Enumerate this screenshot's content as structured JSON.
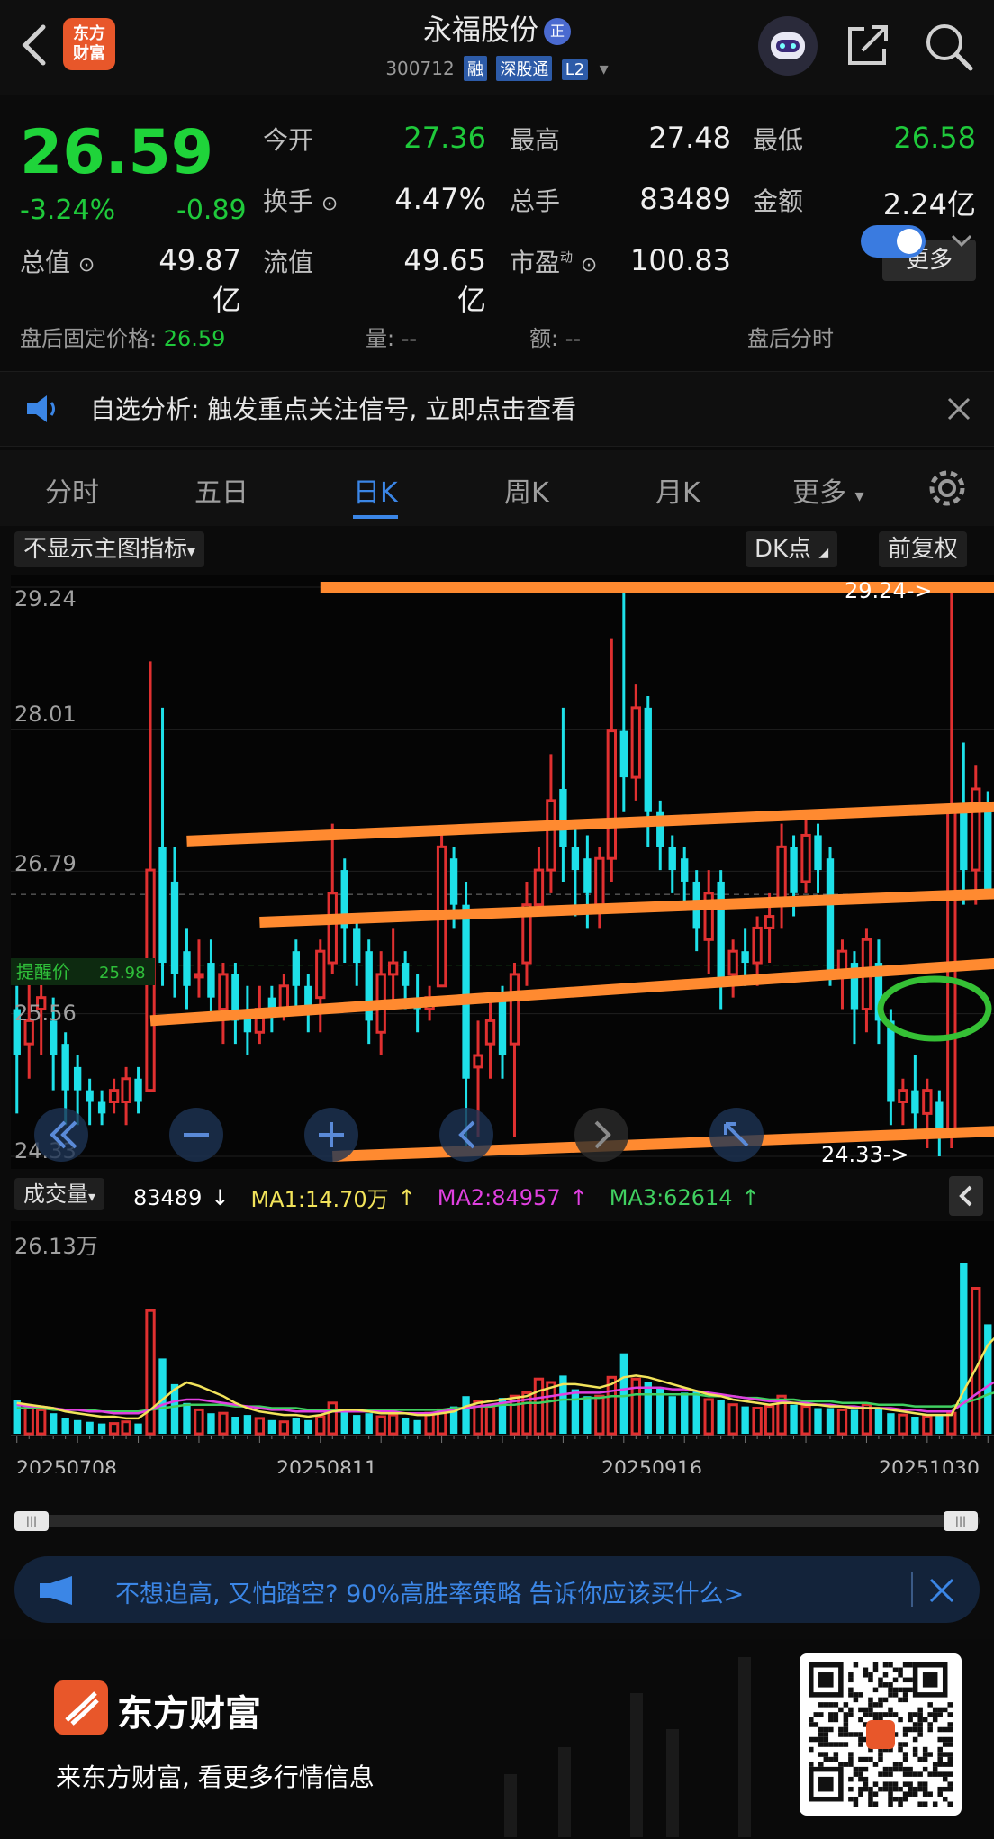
{
  "header": {
    "title": "永福股份",
    "title_badge": "正",
    "code": "300712",
    "tags": [
      "融",
      "深股通",
      "L2"
    ],
    "logo_text": "东方\n财富"
  },
  "quote": {
    "price": "26.59",
    "change_pct": "-3.24%",
    "change_amt": "-0.89",
    "fields": [
      {
        "label": "今开",
        "value": "27.36",
        "color": "green"
      },
      {
        "label": "最高",
        "value": "27.48",
        "color": "white"
      },
      {
        "label": "最低",
        "value": "26.58",
        "color": "green"
      },
      {
        "label": "换手",
        "value": "4.47%",
        "color": "white"
      },
      {
        "label": "总手",
        "value": "83489",
        "color": "white"
      },
      {
        "label": "金额",
        "value": "2.24亿",
        "color": "white"
      },
      {
        "label": "总值",
        "value": "49.87亿",
        "color": "white"
      },
      {
        "label": "流值",
        "value": "49.65亿",
        "color": "white"
      },
      {
        "label": "市盈",
        "value": "100.83",
        "color": "white"
      }
    ],
    "pe_sup": "动",
    "more_label": "更多",
    "after_hours_label": "盘后固定价格:",
    "after_hours_value": "26.59",
    "vol_label": "量:",
    "vol_value": "--",
    "amt_label": "额:",
    "amt_value": "--",
    "after_hours_timeshare": "盘后分时"
  },
  "notice": {
    "text": "自选分析: 触发重点关注信号, 立即点击查看"
  },
  "tabs": [
    "分时",
    "五日",
    "日K",
    "周K",
    "月K",
    "更多"
  ],
  "active_tab": 2,
  "chart_controls": {
    "indicator": "不显示主图指标",
    "dk": "DK点",
    "adjust": "前复权",
    "alert_label": "提醒价",
    "alert_value": "25.98",
    "max_label": "29.24->",
    "min_label": "24.33->",
    "vol_indicator": "成交量",
    "vol_value": "83489",
    "ma1": "MA1:14.70万",
    "ma2": "MA2:84957",
    "ma3": "MA3:62614",
    "vol_axis_top": "26.13万"
  },
  "chart_data": {
    "type": "candlestick",
    "y_ticks": [
      "29.24",
      "28.01",
      "26.79",
      "25.56",
      "24.33"
    ],
    "ylim": [
      24.33,
      29.24
    ],
    "x_ticks": [
      "20250708",
      "20250811",
      "20250916",
      "20251030"
    ],
    "colors": {
      "up": "#e03030",
      "down": "#1ee0e8",
      "trend": "#ff8a30",
      "ma1": "#f2e35a",
      "ma2": "#e040e0",
      "ma3": "#40d060",
      "circle": "#35c035"
    },
    "candles": [
      {
        "o": 25.6,
        "c": 25.2,
        "h": 25.8,
        "l": 24.7
      },
      {
        "o": 25.3,
        "c": 25.5,
        "h": 25.9,
        "l": 25.0
      },
      {
        "o": 25.6,
        "c": 25.7,
        "h": 25.9,
        "l": 25.2
      },
      {
        "o": 25.5,
        "c": 25.2,
        "h": 25.7,
        "l": 24.9
      },
      {
        "o": 25.3,
        "c": 24.9,
        "h": 25.4,
        "l": 24.6
      },
      {
        "o": 25.1,
        "c": 24.9,
        "h": 25.2,
        "l": 24.6
      },
      {
        "o": 24.9,
        "c": 24.8,
        "h": 25.0,
        "l": 24.6
      },
      {
        "o": 24.8,
        "c": 24.7,
        "h": 24.9,
        "l": 24.6
      },
      {
        "o": 24.8,
        "c": 24.9,
        "h": 25.0,
        "l": 24.7
      },
      {
        "o": 24.8,
        "c": 25.0,
        "h": 25.1,
        "l": 24.6
      },
      {
        "o": 25.0,
        "c": 24.8,
        "h": 25.1,
        "l": 24.7
      },
      {
        "o": 24.9,
        "c": 26.8,
        "h": 28.6,
        "l": 24.9
      },
      {
        "o": 27.0,
        "c": 26.0,
        "h": 28.2,
        "l": 25.8
      },
      {
        "o": 26.7,
        "c": 25.9,
        "h": 27.0,
        "l": 25.7
      },
      {
        "o": 26.1,
        "c": 25.8,
        "h": 26.3,
        "l": 25.6
      },
      {
        "o": 25.9,
        "c": 25.9,
        "h": 26.2,
        "l": 25.7
      },
      {
        "o": 26.0,
        "c": 25.7,
        "h": 26.2,
        "l": 25.5
      },
      {
        "o": 25.6,
        "c": 25.9,
        "h": 26.0,
        "l": 25.3
      },
      {
        "o": 25.9,
        "c": 25.5,
        "h": 26.0,
        "l": 25.3
      },
      {
        "o": 25.6,
        "c": 25.4,
        "h": 25.8,
        "l": 25.2
      },
      {
        "o": 25.4,
        "c": 25.6,
        "h": 25.8,
        "l": 25.3
      },
      {
        "o": 25.7,
        "c": 25.6,
        "h": 25.8,
        "l": 25.4
      },
      {
        "o": 25.6,
        "c": 25.8,
        "h": 25.9,
        "l": 25.5
      },
      {
        "o": 26.1,
        "c": 25.8,
        "h": 26.2,
        "l": 25.6
      },
      {
        "o": 25.8,
        "c": 25.6,
        "h": 25.9,
        "l": 25.4
      },
      {
        "o": 25.7,
        "c": 26.1,
        "h": 26.2,
        "l": 25.4
      },
      {
        "o": 26.0,
        "c": 26.6,
        "h": 27.2,
        "l": 25.9
      },
      {
        "o": 26.8,
        "c": 26.3,
        "h": 26.9,
        "l": 26.0
      },
      {
        "o": 26.3,
        "c": 26.0,
        "h": 26.4,
        "l": 25.8
      },
      {
        "o": 26.1,
        "c": 25.5,
        "h": 26.2,
        "l": 25.3
      },
      {
        "o": 25.4,
        "c": 25.9,
        "h": 26.1,
        "l": 25.2
      },
      {
        "o": 25.9,
        "c": 26.0,
        "h": 26.3,
        "l": 25.6
      },
      {
        "o": 26.0,
        "c": 25.8,
        "h": 26.1,
        "l": 25.6
      },
      {
        "o": 25.7,
        "c": 25.6,
        "h": 25.9,
        "l": 25.4
      },
      {
        "o": 25.6,
        "c": 25.7,
        "h": 25.8,
        "l": 25.5
      },
      {
        "o": 25.8,
        "c": 27.0,
        "h": 27.1,
        "l": 25.8
      },
      {
        "o": 26.9,
        "c": 26.5,
        "h": 27.0,
        "l": 26.3
      },
      {
        "o": 26.5,
        "c": 25.0,
        "h": 26.7,
        "l": 24.4
      },
      {
        "o": 25.1,
        "c": 25.2,
        "h": 25.5,
        "l": 24.5
      },
      {
        "o": 25.3,
        "c": 25.5,
        "h": 25.7,
        "l": 25.0
      },
      {
        "o": 25.7,
        "c": 25.2,
        "h": 25.8,
        "l": 25.0
      },
      {
        "o": 25.3,
        "c": 25.9,
        "h": 26.0,
        "l": 24.5
      },
      {
        "o": 26.0,
        "c": 26.5,
        "h": 26.7,
        "l": 25.8
      },
      {
        "o": 26.5,
        "c": 26.8,
        "h": 27.0,
        "l": 26.4
      },
      {
        "o": 26.8,
        "c": 27.4,
        "h": 27.8,
        "l": 26.6
      },
      {
        "o": 27.5,
        "c": 27.0,
        "h": 28.2,
        "l": 26.7
      },
      {
        "o": 27.0,
        "c": 26.8,
        "h": 27.2,
        "l": 26.4
      },
      {
        "o": 26.9,
        "c": 26.6,
        "h": 27.1,
        "l": 26.3
      },
      {
        "o": 26.5,
        "c": 26.9,
        "h": 27.0,
        "l": 26.3
      },
      {
        "o": 26.9,
        "c": 28.0,
        "h": 28.8,
        "l": 26.7
      },
      {
        "o": 28.0,
        "c": 27.6,
        "h": 29.24,
        "l": 27.3
      },
      {
        "o": 27.6,
        "c": 28.2,
        "h": 28.4,
        "l": 27.4
      },
      {
        "o": 28.2,
        "c": 27.3,
        "h": 28.3,
        "l": 27.0
      },
      {
        "o": 27.3,
        "c": 27.0,
        "h": 27.4,
        "l": 26.8
      },
      {
        "o": 27.0,
        "c": 26.8,
        "h": 27.1,
        "l": 26.6
      },
      {
        "o": 26.9,
        "c": 26.7,
        "h": 27.0,
        "l": 26.5
      },
      {
        "o": 26.7,
        "c": 26.3,
        "h": 26.8,
        "l": 26.1
      },
      {
        "o": 26.2,
        "c": 26.6,
        "h": 26.8,
        "l": 25.9
      },
      {
        "o": 26.7,
        "c": 25.8,
        "h": 26.8,
        "l": 25.6
      },
      {
        "o": 25.9,
        "c": 26.1,
        "h": 26.2,
        "l": 25.7
      },
      {
        "o": 26.1,
        "c": 26.0,
        "h": 26.3,
        "l": 25.8
      },
      {
        "o": 26.0,
        "c": 26.3,
        "h": 26.4,
        "l": 25.8
      },
      {
        "o": 26.3,
        "c": 26.4,
        "h": 26.6,
        "l": 26.0
      },
      {
        "o": 26.5,
        "c": 27.0,
        "h": 27.2,
        "l": 26.3
      },
      {
        "o": 27.0,
        "c": 26.6,
        "h": 27.1,
        "l": 26.4
      },
      {
        "o": 26.7,
        "c": 27.1,
        "h": 27.3,
        "l": 26.6
      },
      {
        "o": 27.1,
        "c": 26.8,
        "h": 27.2,
        "l": 26.6
      },
      {
        "o": 26.9,
        "c": 25.9,
        "h": 27.0,
        "l": 25.8
      },
      {
        "o": 25.9,
        "c": 26.1,
        "h": 26.2,
        "l": 25.6
      },
      {
        "o": 26.0,
        "c": 25.6,
        "h": 26.1,
        "l": 25.3
      },
      {
        "o": 25.6,
        "c": 26.2,
        "h": 26.3,
        "l": 25.4
      },
      {
        "o": 26.0,
        "c": 25.5,
        "h": 26.2,
        "l": 25.3
      },
      {
        "o": 25.5,
        "c": 24.8,
        "h": 25.6,
        "l": 24.6
      },
      {
        "o": 24.8,
        "c": 24.9,
        "h": 25.0,
        "l": 24.6
      },
      {
        "o": 24.9,
        "c": 24.7,
        "h": 25.2,
        "l": 24.5
      },
      {
        "o": 24.7,
        "c": 24.9,
        "h": 25.0,
        "l": 24.4
      },
      {
        "o": 24.8,
        "c": 24.5,
        "h": 24.9,
        "l": 24.33
      },
      {
        "o": 24.5,
        "c": 27.3,
        "h": 29.24,
        "l": 24.4
      },
      {
        "o": 27.3,
        "c": 26.8,
        "h": 27.9,
        "l": 26.5
      },
      {
        "o": 26.8,
        "c": 27.5,
        "h": 27.7,
        "l": 26.5
      },
      {
        "o": 27.3,
        "c": 26.59,
        "h": 27.48,
        "l": 26.58
      }
    ],
    "volumes": [
      0.2,
      0.15,
      0.14,
      0.12,
      0.09,
      0.08,
      0.07,
      0.06,
      0.06,
      0.07,
      0.06,
      0.72,
      0.44,
      0.29,
      0.18,
      0.14,
      0.12,
      0.12,
      0.1,
      0.11,
      0.09,
      0.08,
      0.07,
      0.09,
      0.08,
      0.1,
      0.18,
      0.13,
      0.11,
      0.12,
      0.1,
      0.11,
      0.09,
      0.08,
      0.12,
      0.14,
      0.16,
      0.22,
      0.19,
      0.16,
      0.21,
      0.22,
      0.24,
      0.32,
      0.3,
      0.34,
      0.26,
      0.22,
      0.22,
      0.33,
      0.47,
      0.32,
      0.3,
      0.27,
      0.22,
      0.24,
      0.25,
      0.2,
      0.2,
      0.17,
      0.16,
      0.15,
      0.16,
      0.22,
      0.17,
      0.16,
      0.15,
      0.15,
      0.14,
      0.14,
      0.17,
      0.15,
      0.12,
      0.11,
      0.1,
      0.1,
      0.11,
      0.12,
      1.0,
      0.85,
      0.64,
      0.6
    ],
    "ma1": [
      0.18,
      0.17,
      0.16,
      0.15,
      0.13,
      0.12,
      0.11,
      0.1,
      0.1,
      0.09,
      0.09,
      0.14,
      0.2,
      0.26,
      0.3,
      0.28,
      0.25,
      0.22,
      0.18,
      0.15,
      0.13,
      0.12,
      0.11,
      0.11,
      0.1,
      0.11,
      0.13,
      0.14,
      0.14,
      0.13,
      0.12,
      0.12,
      0.12,
      0.11,
      0.11,
      0.12,
      0.13,
      0.16,
      0.18,
      0.19,
      0.2,
      0.21,
      0.22,
      0.25,
      0.27,
      0.29,
      0.29,
      0.28,
      0.27,
      0.29,
      0.33,
      0.34,
      0.33,
      0.31,
      0.29,
      0.27,
      0.25,
      0.23,
      0.22,
      0.2,
      0.19,
      0.18,
      0.17,
      0.18,
      0.18,
      0.17,
      0.17,
      0.16,
      0.16,
      0.15,
      0.15,
      0.15,
      0.14,
      0.13,
      0.12,
      0.11,
      0.11,
      0.11,
      0.25,
      0.38,
      0.52,
      0.59
    ],
    "ma2": [
      0.17,
      0.16,
      0.16,
      0.15,
      0.14,
      0.14,
      0.13,
      0.13,
      0.12,
      0.12,
      0.12,
      0.14,
      0.17,
      0.19,
      0.2,
      0.2,
      0.19,
      0.18,
      0.17,
      0.16,
      0.15,
      0.14,
      0.14,
      0.13,
      0.13,
      0.13,
      0.13,
      0.13,
      0.13,
      0.13,
      0.13,
      0.13,
      0.12,
      0.12,
      0.12,
      0.13,
      0.14,
      0.15,
      0.16,
      0.17,
      0.18,
      0.19,
      0.2,
      0.21,
      0.22,
      0.23,
      0.24,
      0.24,
      0.24,
      0.25,
      0.26,
      0.27,
      0.27,
      0.27,
      0.26,
      0.26,
      0.25,
      0.24,
      0.23,
      0.22,
      0.21,
      0.2,
      0.19,
      0.19,
      0.18,
      0.18,
      0.17,
      0.17,
      0.16,
      0.16,
      0.15,
      0.15,
      0.15,
      0.14,
      0.14,
      0.13,
      0.13,
      0.13,
      0.18,
      0.23,
      0.28,
      0.32
    ],
    "ma3": [
      0.15,
      0.15,
      0.15,
      0.14,
      0.14,
      0.14,
      0.14,
      0.13,
      0.13,
      0.13,
      0.13,
      0.14,
      0.15,
      0.16,
      0.17,
      0.17,
      0.17,
      0.17,
      0.16,
      0.16,
      0.16,
      0.15,
      0.15,
      0.15,
      0.14,
      0.14,
      0.14,
      0.14,
      0.14,
      0.14,
      0.14,
      0.14,
      0.14,
      0.14,
      0.14,
      0.14,
      0.15,
      0.15,
      0.16,
      0.16,
      0.17,
      0.17,
      0.18,
      0.18,
      0.19,
      0.2,
      0.2,
      0.21,
      0.21,
      0.22,
      0.22,
      0.23,
      0.23,
      0.23,
      0.23,
      0.23,
      0.23,
      0.22,
      0.22,
      0.22,
      0.21,
      0.21,
      0.2,
      0.2,
      0.2,
      0.19,
      0.19,
      0.19,
      0.18,
      0.18,
      0.18,
      0.17,
      0.17,
      0.17,
      0.16,
      0.16,
      0.16,
      0.16,
      0.18,
      0.2,
      0.23,
      0.25
    ]
  },
  "banner": {
    "text": "不想追高, 又怕踏空? 90%高胜率策略 告诉你应该买什么>"
  },
  "footer": {
    "brand": "东方财富",
    "slogan": "来东方财富, 看更多行情信息"
  }
}
